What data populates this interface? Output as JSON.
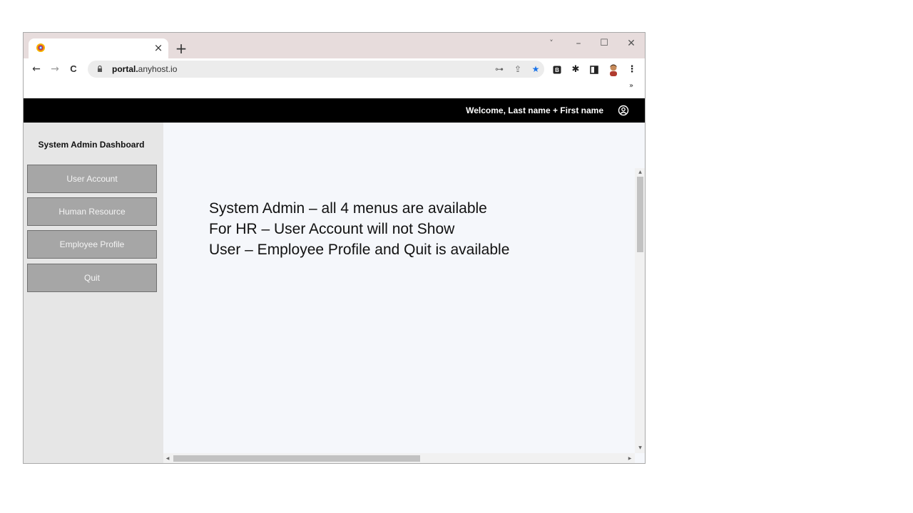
{
  "browser": {
    "tab": {
      "title": "",
      "close_icon": "close-icon",
      "favicon": "app-favicon"
    },
    "new_tab_label": "+",
    "window_controls": {
      "dropdown": "˅",
      "minimize": "–",
      "maximize": "☐",
      "close": "✕"
    },
    "nav": {
      "back": "←",
      "forward": "→",
      "reload": "C"
    },
    "address": {
      "domain": "portal.",
      "rest": "anyhost.io"
    },
    "omnibox_icons": [
      "key-icon",
      "share-icon",
      "star-icon"
    ],
    "toolbar_icons": [
      "extension-b-icon",
      "puzzle-icon",
      "sidepanel-icon",
      "profile-avatar-icon",
      "kebab-menu-icon"
    ],
    "overflow_chevron": "»"
  },
  "header": {
    "welcome_text": "Welcome,  Last name + First name",
    "user_icon": "user-circle-icon"
  },
  "sidebar": {
    "title": "System Admin Dashboard",
    "items": [
      {
        "label": "User Account"
      },
      {
        "label": "Human Resource"
      },
      {
        "label": "Employee Profile"
      },
      {
        "label": "Quit"
      }
    ]
  },
  "main": {
    "notes": [
      "System Admin – all 4 menus are available",
      "For HR – User Account will not Show",
      "User – Employee Profile and Quit is available"
    ]
  },
  "colors": {
    "tabstrip_bg": "#e7dcdc",
    "header_bg": "#000000",
    "sidebar_bg": "#e6e6e6",
    "menu_button_bg": "#a6a6a6",
    "main_bg": "#f5f7fb",
    "star_blue": "#1a73e8"
  }
}
